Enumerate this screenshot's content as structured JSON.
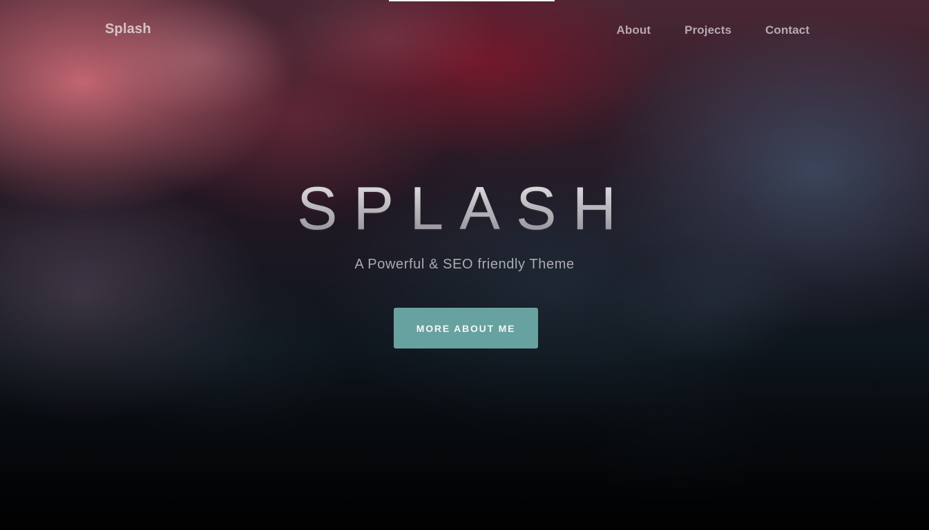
{
  "site": {
    "brand": "Splash",
    "nav": {
      "items": [
        {
          "label": "About"
        },
        {
          "label": "Projects"
        },
        {
          "label": "Contact"
        }
      ]
    },
    "hero": {
      "title": "SPLASH",
      "subtitle": "A Powerful & SEO friendly Theme",
      "cta_label": "MORE ABOUT ME"
    }
  },
  "colors": {
    "accent": "#67a1a0",
    "title_text": "#b8b6bb",
    "nav_text": "#dbd6dc",
    "background_dark": "#07080c",
    "background_red": "#7a182c",
    "background_pink": "#d6707c",
    "background_blue": "#465670"
  },
  "icons": []
}
